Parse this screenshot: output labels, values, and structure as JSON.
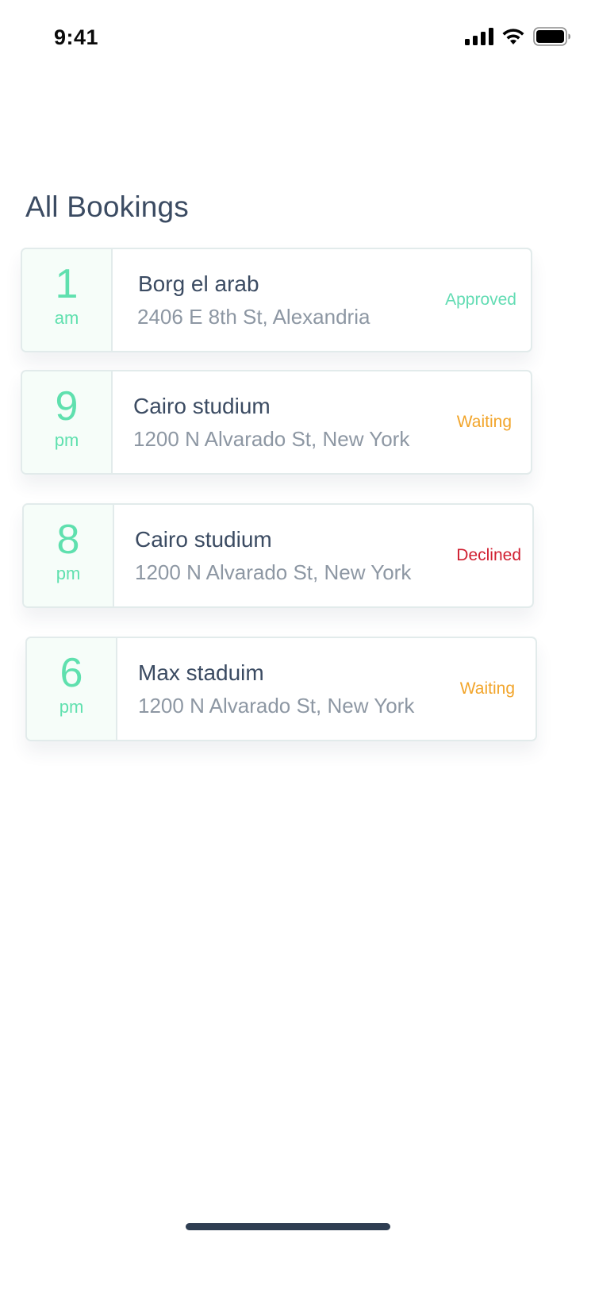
{
  "status_bar": {
    "time": "9:41",
    "signal_icon": "cellular-signal-icon",
    "wifi_icon": "wifi-icon",
    "battery_icon": "battery-icon"
  },
  "page_title": "All Bookings",
  "colors": {
    "approved": "#62dcb3",
    "waiting": "#f2a52b",
    "declined": "#d01f30",
    "time_accent": "#5fe0ae"
  },
  "bookings": [
    {
      "hour": "1",
      "period": "am",
      "name": "Borg el arab",
      "address": "2406 E 8th St, Alexandria",
      "status": "Approved"
    },
    {
      "hour": "9",
      "period": "pm",
      "name": "Cairo studium",
      "address": "1200 N Alvarado St, New York",
      "status": "Waiting"
    },
    {
      "hour": "8",
      "period": "pm",
      "name": "Cairo studium",
      "address": "1200 N Alvarado St, New York",
      "status": "Declined"
    },
    {
      "hour": "6",
      "period": "pm",
      "name": "Max staduim",
      "address": "1200 N Alvarado St, New York",
      "status": "Waiting"
    }
  ]
}
